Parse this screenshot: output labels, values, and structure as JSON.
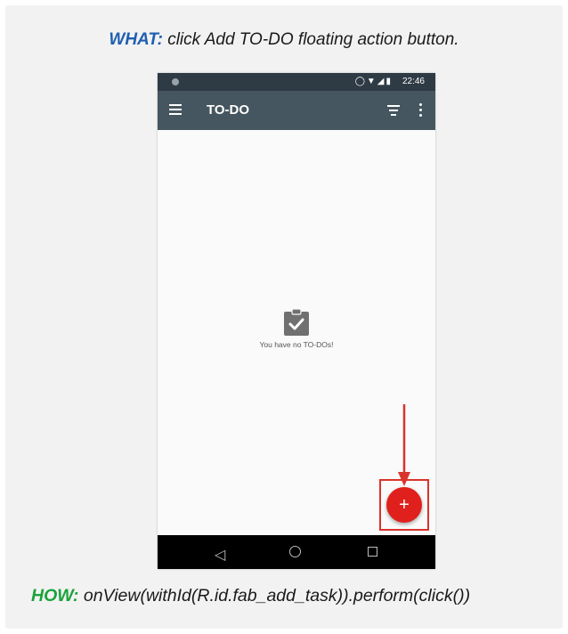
{
  "what": {
    "key": "WHAT:",
    "text": "click Add TO-DO floating action button."
  },
  "how": {
    "key": "HOW:",
    "text": "onView(withId(R.id.fab_add_task)).perform(click())"
  },
  "status_bar": {
    "time": "22:46"
  },
  "app_bar": {
    "title": "TO-DO"
  },
  "empty_state": {
    "message": "You have no TO-DOs!"
  },
  "fab": {
    "label": "+"
  },
  "colors": {
    "what_key": "#1f5fb0",
    "how_key": "#1aa33a",
    "app_bar": "#455660",
    "fab": "#e0201c",
    "highlight": "#d9342b"
  }
}
